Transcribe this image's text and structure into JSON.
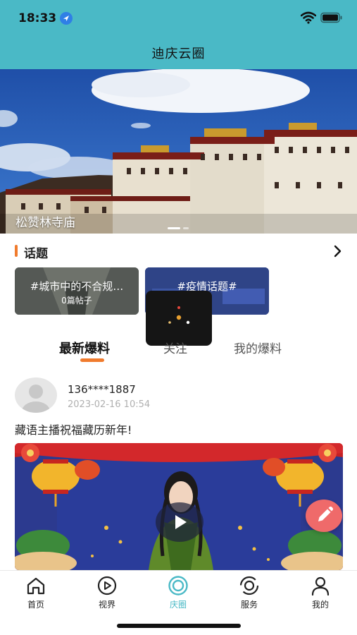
{
  "status_bar": {
    "time": "18:33",
    "location_icon": "location-arrow-icon",
    "wifi_icon": "wifi-icon",
    "battery_icon": "battery-icon"
  },
  "header": {
    "title": "迪庆云圈",
    "background": "#4ab9c6"
  },
  "banner": {
    "caption": "松赞林寺庙",
    "slide_count": 2,
    "active_slide": 1
  },
  "topics": {
    "title": "话题",
    "accent": "#f07b2d",
    "more_icon": "chevron-right-icon",
    "items": [
      {
        "title": "#城市中的不合规…",
        "count": "0篇帖子"
      },
      {
        "title": "#疫情话题#",
        "count": ""
      }
    ]
  },
  "tabs": [
    {
      "label": "最新爆料",
      "active": true
    },
    {
      "label": "关注",
      "active": false
    },
    {
      "label": "我的爆料",
      "active": false
    }
  ],
  "post": {
    "user": "136****1887",
    "time": "2023-02-16 10:54",
    "text": "藏语主播祝福藏历新年!",
    "media_type": "video"
  },
  "bottom_nav": [
    {
      "label": "首页",
      "icon": "home-icon",
      "active": false
    },
    {
      "label": "视界",
      "icon": "play-circle-icon",
      "active": false
    },
    {
      "label": "庆圈",
      "icon": "circle-ring-icon",
      "active": true
    },
    {
      "label": "服务",
      "icon": "service-swirl-icon",
      "active": false
    },
    {
      "label": "我的",
      "icon": "user-icon",
      "active": false
    }
  ],
  "colors": {
    "active_nav": "#4ab9c6",
    "accent": "#f07b2d",
    "edit_fab": "#ef6a6a"
  }
}
